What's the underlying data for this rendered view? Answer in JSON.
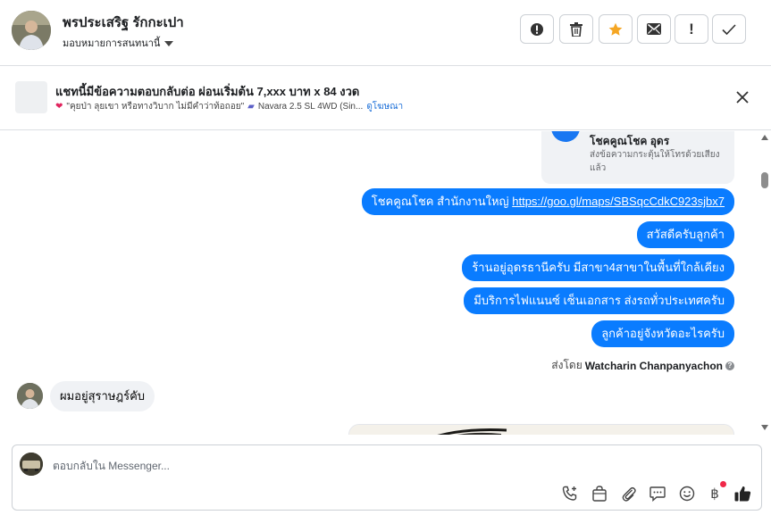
{
  "header": {
    "name": "พรประเสริฐ รักกะเปา",
    "assign_label": "มอบหมายการสนทนานี้",
    "actions": [
      {
        "icon": "alert-circle-icon",
        "name": "mark-spam-button"
      },
      {
        "icon": "trash-icon",
        "name": "delete-button"
      },
      {
        "icon": "star-icon",
        "name": "star-button"
      },
      {
        "icon": "envelope-icon",
        "name": "mark-unread-button"
      },
      {
        "icon": "exclamation-icon",
        "name": "follow-up-button"
      },
      {
        "icon": "check-icon",
        "name": "mark-done-button"
      }
    ],
    "exclaim_glyph": "!",
    "accent_star": "#f5a623"
  },
  "ad": {
    "title": "แชทนี้มีข้อความตอบกลับต่อ ผ่อนเริ่มต้น 7,xxx บาท x 84 งวด",
    "subtitle": "\"คุยป่า ลุยเขา หรือทางวิบาก ไม่มีคำว่าท้อถอย\"",
    "model": "Navara 2.5 SL 4WD (Sin...",
    "link": "ดูโฆษณา"
  },
  "thread": {
    "card": {
      "title": "โชคคูณโชค อุดร",
      "description": "ส่งข้อความกระตุ้นให้โทรด้วยเสียงแล้ว"
    },
    "outgoing": [
      {
        "prefix": "โชคคูณโชค สำนักงานใหญ่ ",
        "url": "https://goo.gl/maps/SBSqcCdkC923sjbx7"
      },
      {
        "text": "สวัสดีครับลูกค้า"
      },
      {
        "text": "ร้านอยู่อุดรธานีครับ มีสาขา4สาขาในพื้นที่ใกล้เคียง"
      },
      {
        "text": "มีบริการไฟแนนซ์ เซ็นเอกสาร ส่งรถทั่วประเทศครับ"
      },
      {
        "text": "ลูกค้าอยู่จังหวัดอะไรครับ"
      }
    ],
    "sent_by_label": "ส่งโดย",
    "sent_by_name": "Watcharin Chanpanyachon",
    "incoming": [
      {
        "text": "ผมอยู่สุราษฎร์คับ"
      }
    ],
    "bubble_color": "#0a7cff"
  },
  "composer": {
    "placeholder": "ตอบกลับใน Messenger...",
    "baht_glyph": "฿",
    "tools": [
      "phone-plus-icon",
      "shopping-bag-icon",
      "paperclip-icon",
      "chat-bubble-icon",
      "smiley-icon",
      "baht-icon",
      "thumbs-up-icon"
    ]
  }
}
